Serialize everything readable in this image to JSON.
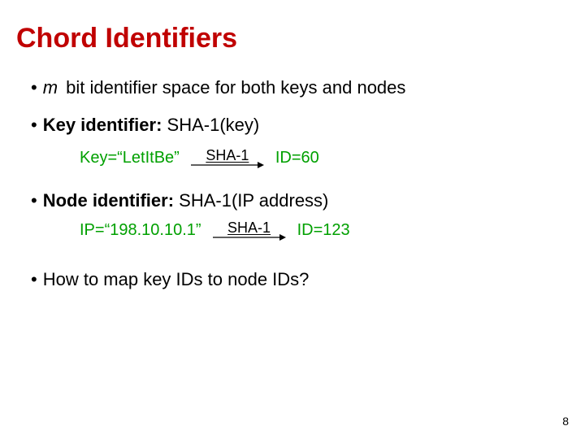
{
  "title": "Chord Identifiers",
  "bullets": {
    "b1_var": "m",
    "b1_rest": "  bit identifier space for both keys and nodes",
    "b2_bold": "Key identifier:",
    "b2_rest": " SHA-1(key)",
    "b3_bold": "Node identifier:",
    "b3_rest": " SHA-1(IP address)",
    "b4": "How to map key IDs to node IDs?"
  },
  "examples": {
    "key_left": "Key=“LetItBe”",
    "key_arrow": "SHA-1",
    "key_right": "ID=60",
    "ip_left": "IP=“198.10.10.1”",
    "ip_arrow": "SHA-1",
    "ip_right": "ID=123"
  },
  "page_number": "8"
}
